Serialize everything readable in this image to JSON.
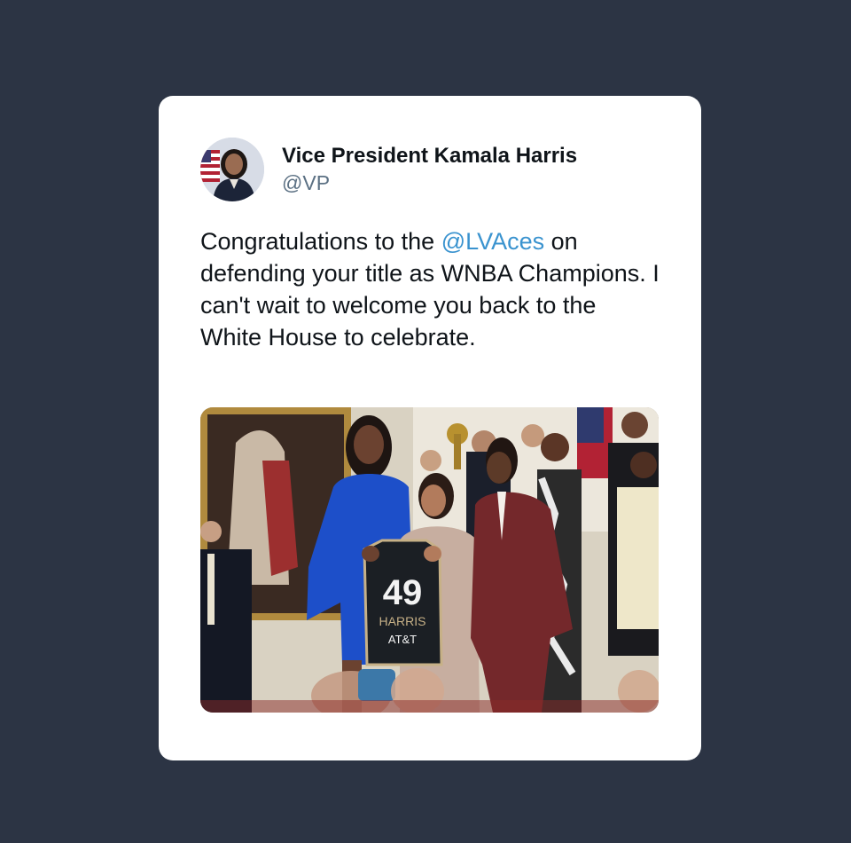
{
  "tweet": {
    "author": {
      "display_name": "Vice President Kamala Harris",
      "handle": "@VP",
      "avatar_icon": "profile-avatar"
    },
    "text": {
      "before_mention": "Congratulations to the ",
      "mention": "@LVAces",
      "after_mention": " on defending your title as WNBA Champions. I can't wait to welcome you back to the White House to celebrate."
    },
    "media": {
      "jersey": {
        "number": "49",
        "name": "HARRIS",
        "sponsor": "AT&T"
      }
    }
  },
  "colors": {
    "background": "#2c3444",
    "card": "#ffffff",
    "mention": "#3a93cf",
    "handle": "#5b7083"
  }
}
